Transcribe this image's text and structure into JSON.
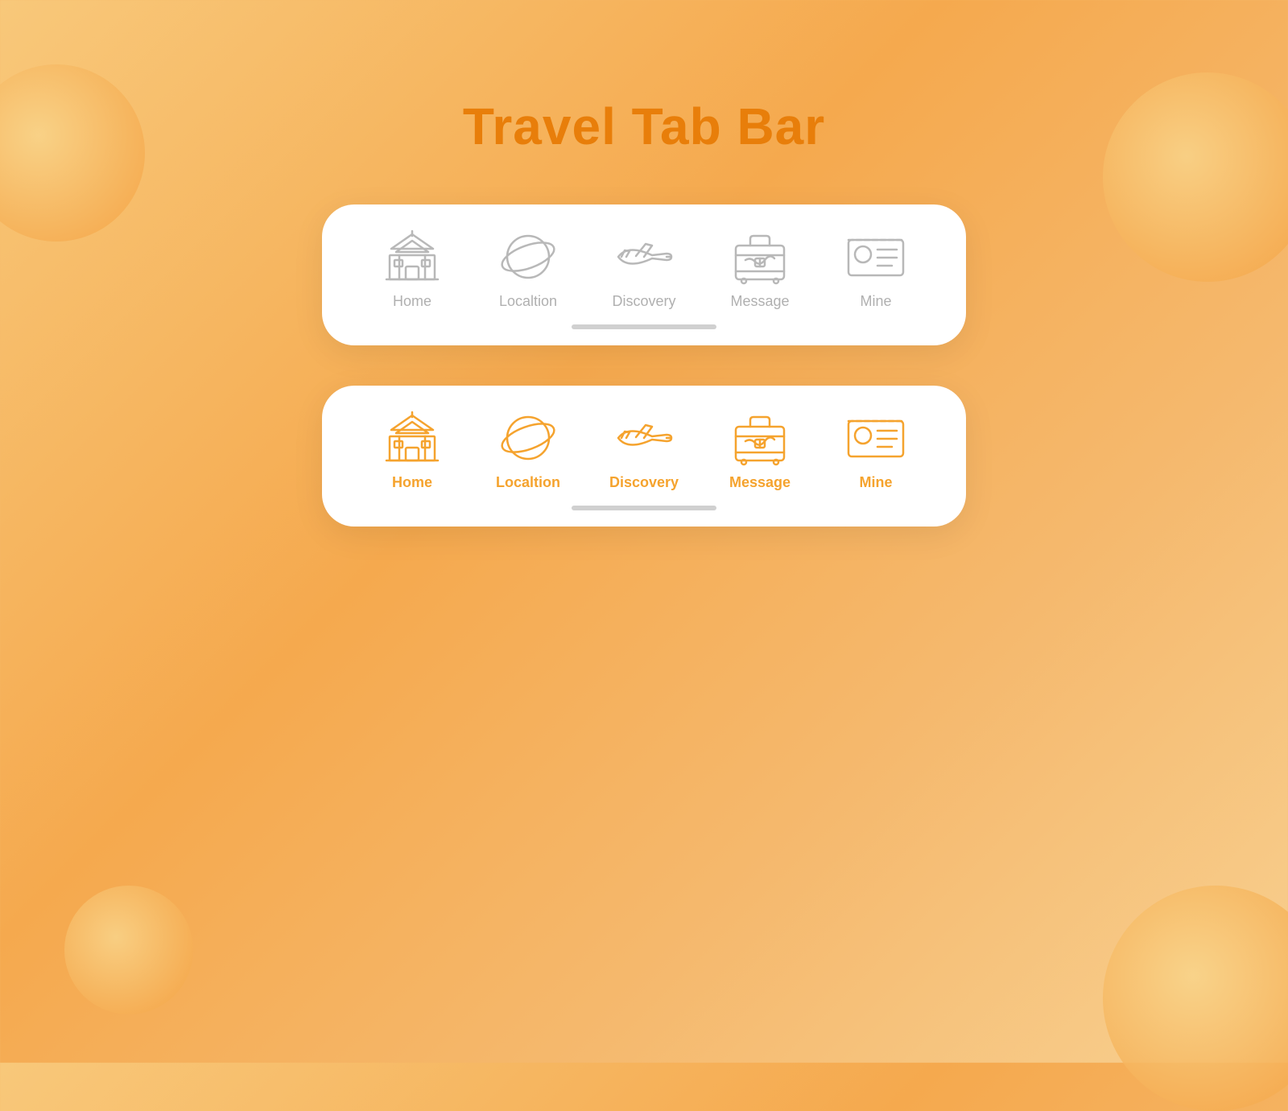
{
  "page": {
    "title": "Travel Tab Bar",
    "title_color": "#e87e0a"
  },
  "tab_bars": [
    {
      "id": "inactive",
      "variant": "inactive",
      "items": [
        {
          "id": "home",
          "label": "Home"
        },
        {
          "id": "location",
          "label": "Localtion"
        },
        {
          "id": "discovery",
          "label": "Discovery"
        },
        {
          "id": "message",
          "label": "Message"
        },
        {
          "id": "mine",
          "label": "Mine"
        }
      ]
    },
    {
      "id": "active",
      "variant": "active",
      "items": [
        {
          "id": "home",
          "label": "Home"
        },
        {
          "id": "location",
          "label": "Localtion"
        },
        {
          "id": "discovery",
          "label": "Discovery"
        },
        {
          "id": "message",
          "label": "Message"
        },
        {
          "id": "mine",
          "label": "Mine"
        }
      ]
    }
  ],
  "decorative": {
    "circles": [
      "top-left",
      "top-right",
      "bottom-left",
      "bottom-right"
    ]
  }
}
